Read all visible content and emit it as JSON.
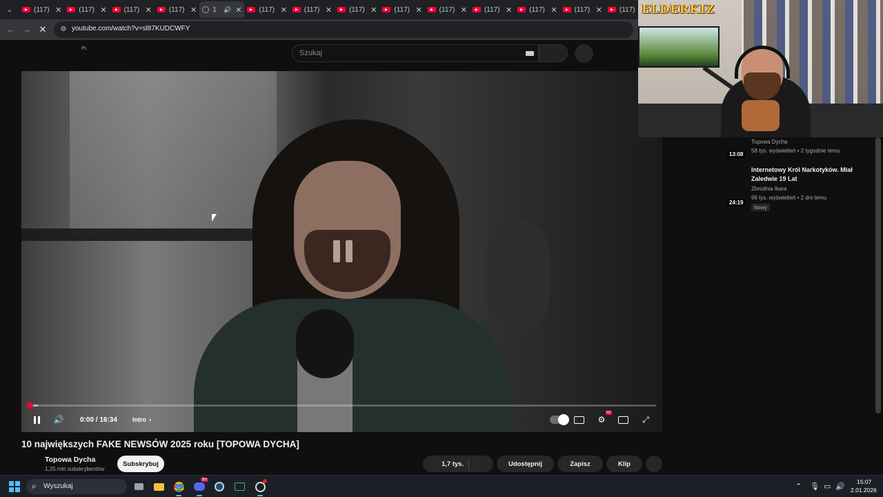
{
  "browser": {
    "tabs": [
      {
        "title": "(117)",
        "active": false
      },
      {
        "title": "(117)",
        "active": false
      },
      {
        "title": "(117)",
        "active": false
      },
      {
        "title": "(117)",
        "active": false
      },
      {
        "title": "1",
        "active": true
      },
      {
        "title": "(117)",
        "active": false
      },
      {
        "title": "(117)",
        "active": false
      },
      {
        "title": "(117)",
        "active": false
      },
      {
        "title": "(117)",
        "active": false
      },
      {
        "title": "(117)",
        "active": false
      },
      {
        "title": "(117)",
        "active": false
      },
      {
        "title": "(117)",
        "active": false
      },
      {
        "title": "(117)",
        "active": false
      },
      {
        "title": "(117)",
        "active": false
      }
    ],
    "url": "youtube.com/watch?v=sl87KUDCWFY",
    "close_glyph": "✕"
  },
  "youtube": {
    "region": "PL",
    "search_placeholder": "Szukaj"
  },
  "player": {
    "time": "0:00 / 16:34",
    "chapter": "Intro",
    "playing": false,
    "progress_fraction": 0.0,
    "buffer_fraction": 0.016
  },
  "video": {
    "title": "10 największych FAKE NEWSÓW 2025 roku [TOPOWA DYCHA]",
    "channel": "Topowa Dycha",
    "subscribers": "1,25 mln subskrybentów",
    "subscribe_label": "Subskrybuj",
    "likes": "1,7 tys.",
    "share_label": "Udostępnij",
    "save_label": "Zapisz",
    "clip_label": "Klip"
  },
  "webcam": {
    "logo_text": "ELDERKIZ"
  },
  "sidebar": {
    "items": [
      {
        "title": "",
        "channel": "Topowa Dycha",
        "meta": "58 tys. wyświetleń • 2 tygodnie temu",
        "duration": "13:08",
        "badge": ""
      },
      {
        "title": "Internetowy Król Narkotyków. Miał Zaledwie 19 Lat",
        "channel": "Zbrodnia Ikara",
        "meta": "96 tys. wyświetleń • 2 dni temu",
        "duration": "24:19",
        "badge": "Nowy"
      }
    ]
  },
  "taskbar": {
    "search_label": "Wyszukaj",
    "time": "15:07",
    "date": "2.01.2026",
    "discord_badge": "9+"
  },
  "colors": {
    "youtube_red": "#ff0033",
    "windows_accent": "#4cc2ff",
    "background": "#0f0f0f"
  }
}
